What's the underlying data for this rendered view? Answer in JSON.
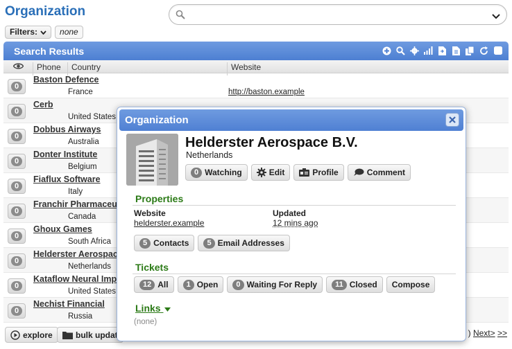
{
  "page": {
    "title": "Organization"
  },
  "search": {
    "placeholder": "",
    "value": ""
  },
  "filters": {
    "label": "Filters:",
    "value": "none"
  },
  "results": {
    "title": "Search Results",
    "columns": {
      "phone": "Phone",
      "country": "Country",
      "website": "Website"
    },
    "rows": [
      {
        "count": "0",
        "name": "Baston Defence",
        "country": "France",
        "website": "http://baston.example"
      },
      {
        "count": "0",
        "name": "Cerb",
        "country": "United States",
        "website": ""
      },
      {
        "count": "0",
        "name": "Dobbus Airways",
        "country": "Australia",
        "website": ""
      },
      {
        "count": "0",
        "name": "Donter Institute",
        "country": "Belgium",
        "website": ""
      },
      {
        "count": "0",
        "name": "Fiaflux Software",
        "country": "Italy",
        "website": ""
      },
      {
        "count": "0",
        "name": "Franchir Pharmaceut",
        "country": "Canada",
        "website": ""
      },
      {
        "count": "0",
        "name": "Ghoux Games",
        "country": "South Africa",
        "website": ""
      },
      {
        "count": "0",
        "name": "Helderster Aerospac",
        "country": "Netherlands",
        "website": ""
      },
      {
        "count": "0",
        "name": "Kataflow Neural Imp",
        "country": "United States",
        "website": ""
      },
      {
        "count": "0",
        "name": "Nechist Financial",
        "country": "Russia",
        "website": ""
      }
    ]
  },
  "bottom": {
    "explore": "explore",
    "bulk_update": "bulk updat",
    "next": "Next>",
    "last": ">>",
    "prev_fragment": ")"
  },
  "popup": {
    "header": "Organization",
    "org_name": "Helderster Aerospace B.V.",
    "org_country": "Netherlands",
    "actions": {
      "watching_count": "0",
      "watching": "Watching",
      "edit": "Edit",
      "profile": "Profile",
      "comment": "Comment"
    },
    "properties": {
      "title": "Properties",
      "website_label": "Website",
      "website_value": "helderster.example",
      "updated_label": "Updated",
      "updated_value": "12 mins ago",
      "contacts_count": "5",
      "contacts": "Contacts",
      "emails_count": "5",
      "emails": "Email Addresses"
    },
    "tickets": {
      "title": "Tickets",
      "all_count": "12",
      "all": "All",
      "open_count": "1",
      "open": "Open",
      "waiting_count": "0",
      "waiting": "Waiting For Reply",
      "closed_count": "11",
      "closed": "Closed",
      "compose": "Compose"
    },
    "links": {
      "title": "Links",
      "none": "(none)"
    }
  },
  "colors": {
    "accent": "#4d7fd2",
    "title": "#2a6fb8",
    "section": "#2b7a16"
  }
}
